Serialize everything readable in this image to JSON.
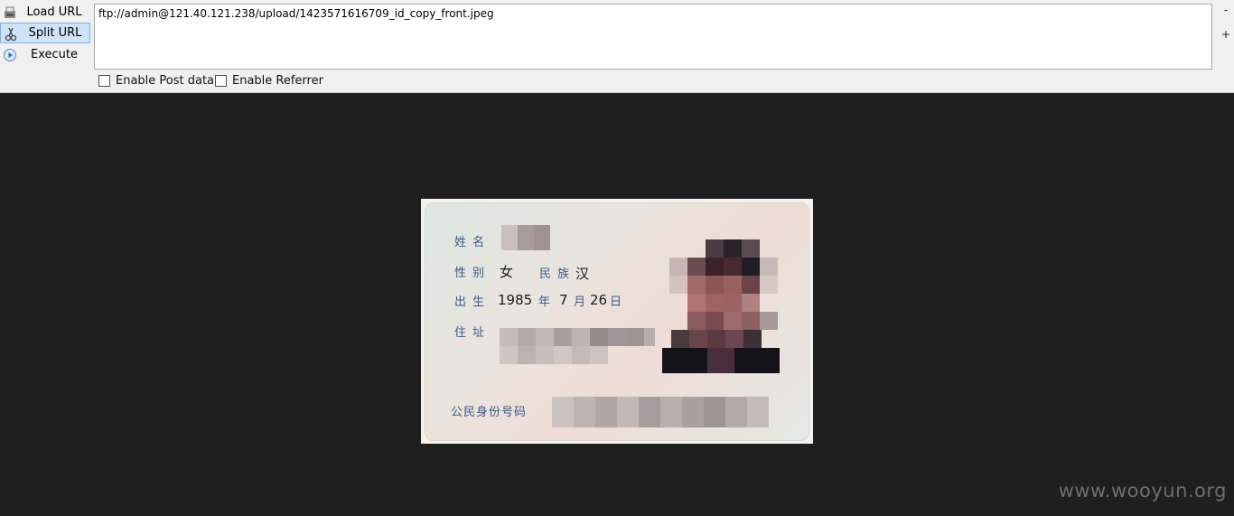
{
  "toolbar": {
    "load_url_label": "Load URL",
    "split_url_label": "Split URL",
    "execute_label": "Execute",
    "url_value": "ftp://admin@121.40.121.238/upload/1423571616709_id_copy_front.jpeg",
    "minus_label": "-",
    "plus_label": "+",
    "enable_post_label": "Enable Post data",
    "enable_referrer_label": "Enable Referrer"
  },
  "card": {
    "name_label": "姓名",
    "gender_label": "性别",
    "gender_value": "女",
    "ethnicity_label": "民族",
    "ethnicity_value": "汉",
    "birth_label": "出生",
    "birth_year": "1985",
    "year_char": "年",
    "birth_month": "7",
    "month_char": "月",
    "birth_day": "26",
    "day_char": "日",
    "address_label": "住址",
    "id_label": "公民身份号码"
  },
  "watermark": "www.wooyun.org",
  "colors": {
    "page_bg": "#1f1f1f",
    "toolbar_bg": "#f0f0f0",
    "selected_btn": "#cfe3f7",
    "card_label": "#3a5a8a"
  }
}
